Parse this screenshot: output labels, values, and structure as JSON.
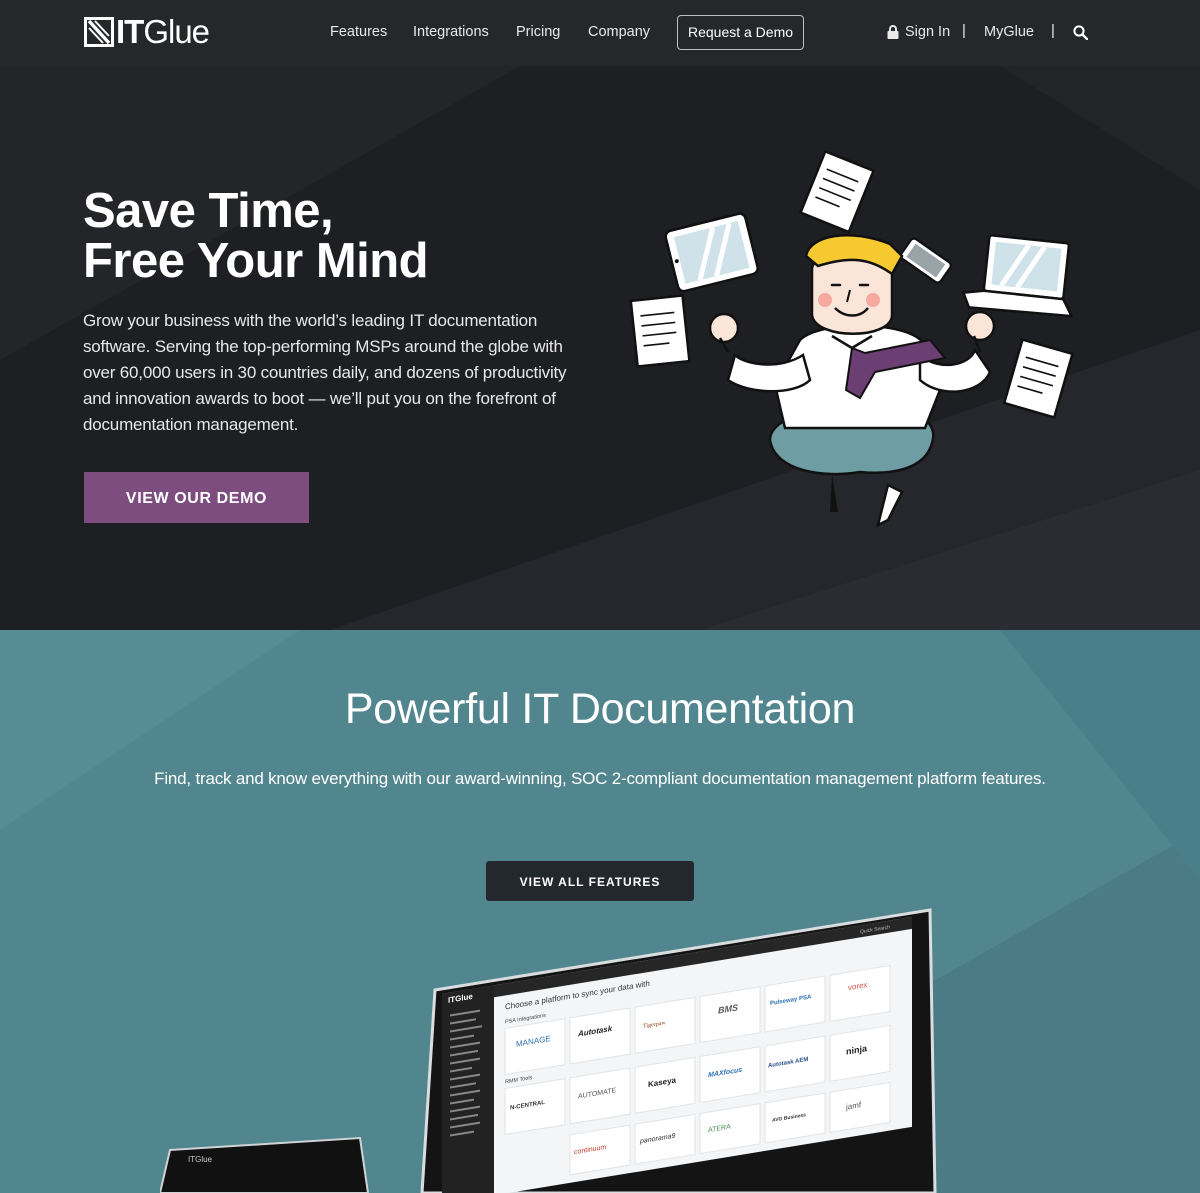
{
  "nav": {
    "logo_bold": "IT",
    "logo_light": "Glue",
    "links": [
      "Features",
      "Integrations",
      "Pricing",
      "Company"
    ],
    "demo_button": "Request a Demo",
    "sign_in": "Sign In",
    "separator": "|",
    "myglue": "MyGlue",
    "icons": {
      "lock": "lock-icon",
      "search": "search-icon",
      "logo": "itglue-logo-mark"
    }
  },
  "hero": {
    "title_line1": "Save Time,",
    "title_line2": "Free Your Mind",
    "copy": "Grow your business with the world’s leading IT documentation software. Serving the top-performing MSPs around the globe with over 60,000 users in 30 countries daily, and dozens of productivity and innovation awards to boot — we’ll put you on the forefront of documentation management.",
    "cta": "VIEW OUR DEMO"
  },
  "features": {
    "title": "Powerful IT Documentation",
    "subtitle": "Find, track and know everything with our award-winning, SOC 2-compliant documentation management platform features.",
    "cta": "VIEW ALL FEATURES"
  },
  "screen": {
    "logo": "ITGlue",
    "heading": "Choose a platform to sync your data with",
    "group_psa": "PSA Integrations",
    "group_rmm": "RMM Tools",
    "psa_tiles": [
      "MANAGE",
      "Autotask",
      "Tigerpaw",
      "BMS",
      "Pulseway PSA",
      "vorex"
    ],
    "rmm_tiles": [
      "N-CENTRAL",
      "AUTOMATE",
      "Kaseya",
      "MAXfocus",
      "Autotask AEM",
      "ninja"
    ],
    "row3_tiles": [
      "continuum",
      "panorama9",
      "ATERA",
      "AVG Business",
      "jamf"
    ],
    "search": "Quick Search"
  },
  "colors": {
    "hero_bg": "#1e1f23",
    "accent_purple": "#7c4d7e",
    "features_bg": "#52868f",
    "features_btn": "#23282d"
  }
}
